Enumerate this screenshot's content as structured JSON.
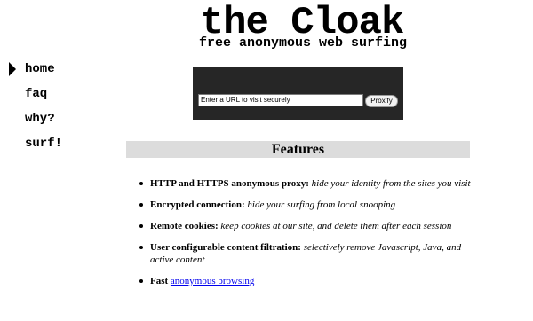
{
  "header": {
    "title": "the Cloak",
    "tagline": "free anonymous web surfing"
  },
  "nav": {
    "items": [
      {
        "label": "home",
        "active": true
      },
      {
        "label": "faq"
      },
      {
        "label": "why?"
      },
      {
        "label": "surf!"
      }
    ]
  },
  "url_form": {
    "input_value": "Enter a URL to visit securely",
    "button_label": "Proxify"
  },
  "features": {
    "heading": "Features",
    "items": [
      {
        "title": "HTTP and HTTPS anonymous proxy:",
        "desc": "hide your identity from the sites you visit"
      },
      {
        "title": "Encrypted connection:",
        "desc": "hide your surfing from local snooping"
      },
      {
        "title": "Remote cookies:",
        "desc": "keep cookies at our site, and delete them after each session"
      },
      {
        "title": "User configurable content filtration:",
        "desc": "selectively remove Javascript, Java, and active content"
      },
      {
        "title": "Fast",
        "link": "anonymous browsing"
      }
    ]
  },
  "colors": {
    "panel_bg": "#262626",
    "heading_bar": "#dcdcdc",
    "link": "#0000ee"
  }
}
